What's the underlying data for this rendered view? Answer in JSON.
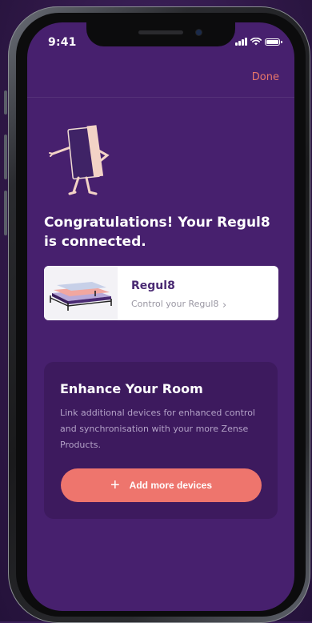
{
  "status_bar": {
    "time": "9:41"
  },
  "header": {
    "done_label": "Done"
  },
  "congrats_text": "Congratulations! Your Regul8 is connected.",
  "device_card": {
    "name": "Regul8",
    "subtitle": "Control your Regul8",
    "chevron": "›"
  },
  "enhance": {
    "title": "Enhance Your Room",
    "description": "Link additional devices for enhanced control and synchronisation with your more Zense Products.",
    "button_label": "Add more devices",
    "button_icon": "+"
  },
  "colors": {
    "screen_bg": "#47206e",
    "accent_coral": "#ee756d",
    "card_dark": "#3d1a5e",
    "done_text": "#e8766a"
  },
  "icons": [
    "signal-icon",
    "wifi-icon",
    "battery-icon",
    "chevron-right-icon",
    "plus-icon",
    "mascot-illustration",
    "bed-illustration"
  ]
}
